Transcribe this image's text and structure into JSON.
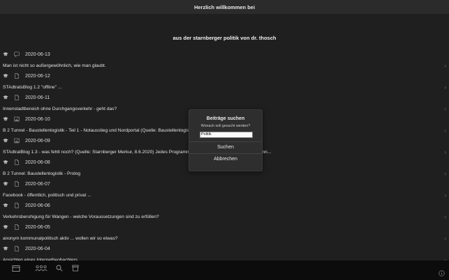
{
  "header": {
    "title": "Herzlich willkommen bei"
  },
  "subtitle": "aus der starnberger politik von dr. thosch",
  "entries": [
    {
      "date": "2020-06-13",
      "icon": "chat-bubble-icon",
      "title": "Man ist nicht so außergewöhnlich, wie man glaubt."
    },
    {
      "date": "2020-06-12",
      "icon": "document-icon",
      "title": "STAdtratsBlog 1.2 \"offline\" ..."
    },
    {
      "date": "2020-06-11",
      "icon": "document-icon",
      "title": "Innenstadtbereich ohne Durchgangsverkehr - geht das?"
    },
    {
      "date": "2020-06-10",
      "icon": "image-icon",
      "title": "B 2 Tunnel - Baustellenlogistik - Teil 1 - Notausstieg und Nordportal (Quelle: Baustellenlogistik - Staatliches Bauamt Weilheim)..."
    },
    {
      "date": "2020-06-09",
      "icon": "image-icon",
      "title": "STAdtratBlog 1.3 - was fehlt noch? (Quelle: Starnberger Merkur, 8.6.2020) Jedes Programm hat am Anfang Schwachstellen, denn..."
    },
    {
      "date": "2020-06-08",
      "icon": "document-icon",
      "title": "B 2 Tunnel: Baustellenlogistik - Prolog"
    },
    {
      "date": "2020-06-07",
      "icon": "document-icon",
      "title": "Facebook - öffentlich, politisch  und privat ..."
    },
    {
      "date": "2020-06-06",
      "icon": "document-icon",
      "title": "Verkehrsberuhigung für Wangen - welche Voraussetzungen sind zu erfüllen?"
    },
    {
      "date": "2020-06-05",
      "icon": "document-icon",
      "title": "anonym kommunalpolitisch aktiv ... wollen wir so etwas?"
    },
    {
      "date": "2020-06-04",
      "icon": "document-icon",
      "title": "Ansichten eines Internetbeobachters ..."
    }
  ],
  "dialog": {
    "title": "Beiträge suchen",
    "message": "Wonach soll gesucht werden?",
    "input_value": "Politik",
    "search_label": "Suchen",
    "cancel_label": "Abbrechen"
  },
  "tabbar": {
    "items": [
      {
        "name": "tab-calendar",
        "icon": "calendar-icon"
      },
      {
        "name": "tab-community",
        "icon": "people-icon"
      },
      {
        "name": "tab-search",
        "icon": "search-icon"
      },
      {
        "name": "tab-archive",
        "icon": "archive-icon"
      }
    ]
  }
}
